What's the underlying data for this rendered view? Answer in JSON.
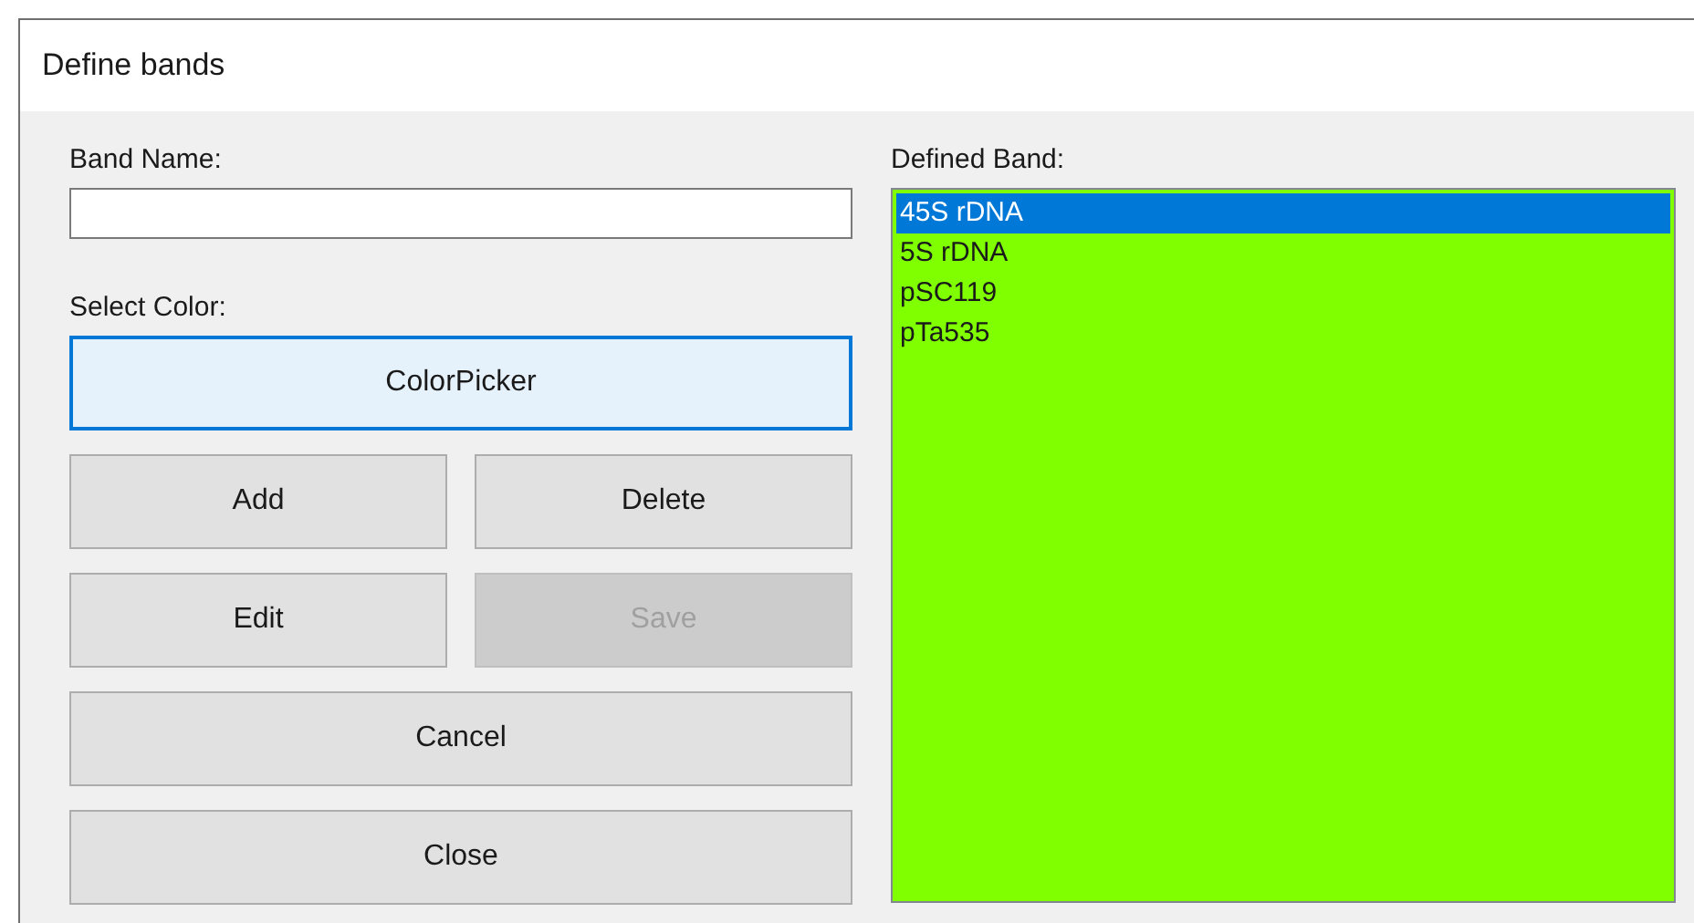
{
  "window": {
    "title": "Define bands"
  },
  "band_name": {
    "label": "Band Name:"
  },
  "select_color": {
    "label": "Select Color:",
    "button": {
      "label": "ColorPicker",
      "focused": true,
      "disabled": false
    }
  },
  "button_rows": [
    [
      {
        "label": "Add",
        "disabled": false,
        "focused": false
      },
      {
        "label": "Delete",
        "disabled": false,
        "focused": false
      }
    ],
    [
      {
        "label": "Edit",
        "disabled": false,
        "focused": false
      },
      {
        "label": "Save",
        "disabled": true,
        "focused": false
      }
    ],
    [
      {
        "label": "Cancel",
        "disabled": false,
        "focused": false
      }
    ],
    [
      {
        "label": "Close",
        "disabled": false,
        "focused": false
      }
    ]
  ],
  "defined_band": {
    "label": "Defined Band:",
    "color": "#80ff00",
    "items": [
      {
        "label": "45S rDNA",
        "selected": true
      },
      {
        "label": "5S rDNA",
        "selected": false
      },
      {
        "label": "pSC119",
        "selected": false
      },
      {
        "label": "pTa535",
        "selected": false
      }
    ]
  }
}
